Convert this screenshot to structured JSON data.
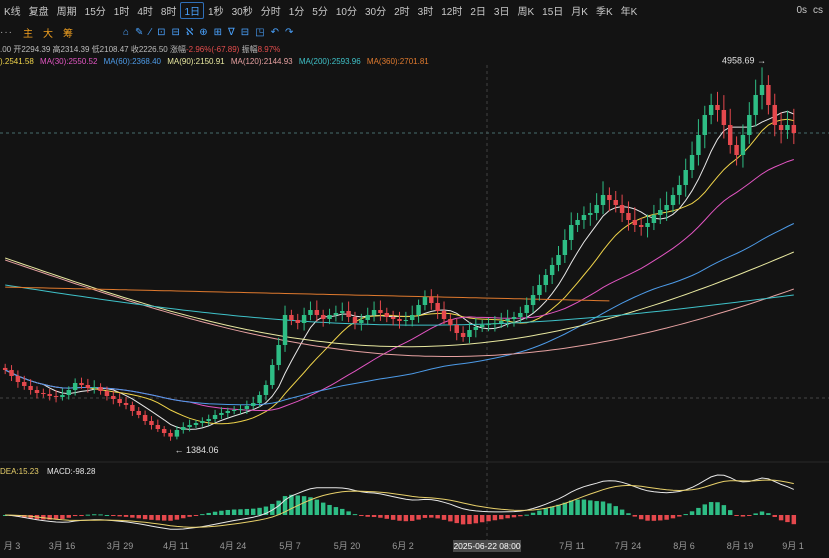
{
  "toolbar": {
    "items": [
      "K线",
      "复盘",
      "周期",
      "15分",
      "1时",
      "4时",
      "8时",
      "1日",
      "1秒",
      "30秒",
      "分时",
      "1分",
      "5分",
      "10分",
      "30分",
      "2时",
      "3时",
      "12时",
      "2日",
      "3日",
      "周K",
      "15日",
      "月K",
      "季K",
      "年K"
    ],
    "active": "1日",
    "right": [
      "0s",
      "cs"
    ]
  },
  "indicator_tabs": [
    "主",
    "大",
    "筹"
  ],
  "ohlc": {
    "open": "2294.39",
    "high": "2314.39",
    "low": "2108.47",
    "close": "2226.50",
    "change": "-2.96%(-67.89)",
    "amplitude": "8.97%",
    "open_label": "开",
    "high_label": "高",
    "low_label": "低",
    "close_label": "收",
    "change_label": "涨幅",
    "amp_label": "振幅",
    "prefix": ".00"
  },
  "ma_legend": [
    {
      "text": ").2541.58",
      "color": "#f0d44a"
    },
    {
      "text": "MA(30):2550.52",
      "color": "#e255c2"
    },
    {
      "text": "MA(60):2368.40",
      "color": "#4d9be8"
    },
    {
      "text": "MA(90):2150.91",
      "color": "#e8e8a0"
    },
    {
      "text": "MA(120):2144.93",
      "color": "#e6a1a1"
    },
    {
      "text": "MA(200):2593.96",
      "color": "#3fc2c9"
    },
    {
      "text": "MA(360):2701.81",
      "color": "#e07a2e"
    }
  ],
  "macd_legend": {
    "dea": "DEA:15.23",
    "macd": "MACD:-98.28"
  },
  "colors": {
    "up": "#2ebd85",
    "down": "#e5484d",
    "background": "#131313"
  },
  "chart_data": {
    "type": "candlestick",
    "annotations": {
      "high": "4958.69",
      "low": "1384.06",
      "crosshair_date": "2025-06-22 08:00"
    },
    "x_tick_labels": [
      "月 3",
      "3月 16",
      "3月 29",
      "4月 11",
      "4月 24",
      "5月 7",
      "5月 20",
      "6月 2",
      "",
      "7月 11",
      "7月 24",
      "8月 6",
      "8月 19",
      "9月 1"
    ],
    "series_close": [
      2050,
      1990,
      1930,
      1890,
      1850,
      1820,
      1810,
      1790,
      1780,
      1800,
      1850,
      1920,
      1900,
      1870,
      1880,
      1840,
      1790,
      1760,
      1720,
      1700,
      1640,
      1600,
      1540,
      1500,
      1460,
      1420,
      1384,
      1450,
      1480,
      1500,
      1520,
      1540,
      1560,
      1600,
      1620,
      1640,
      1650,
      1660,
      1690,
      1720,
      1800,
      1900,
      2100,
      2300,
      2600,
      2550,
      2520,
      2600,
      2650,
      2600,
      2560,
      2600,
      2620,
      2640,
      2580,
      2520,
      2550,
      2600,
      2650,
      2620,
      2580,
      2560,
      2540,
      2550,
      2600,
      2700,
      2780,
      2720,
      2640,
      2560,
      2500,
      2420,
      2380,
      2450,
      2480,
      2500,
      2510,
      2520,
      2540,
      2560,
      2580,
      2620,
      2700,
      2800,
      2900,
      3000,
      3100,
      3200,
      3350,
      3500,
      3550,
      3600,
      3620,
      3700,
      3800,
      3750,
      3700,
      3620,
      3550,
      3500,
      3480,
      3520,
      3600,
      3650,
      3700,
      3800,
      3900,
      4050,
      4200,
      4400,
      4600,
      4700,
      4650,
      4500,
      4300,
      4200,
      4400,
      4600,
      4800,
      4900,
      4700,
      4500,
      4450,
      4500,
      4420
    ]
  }
}
